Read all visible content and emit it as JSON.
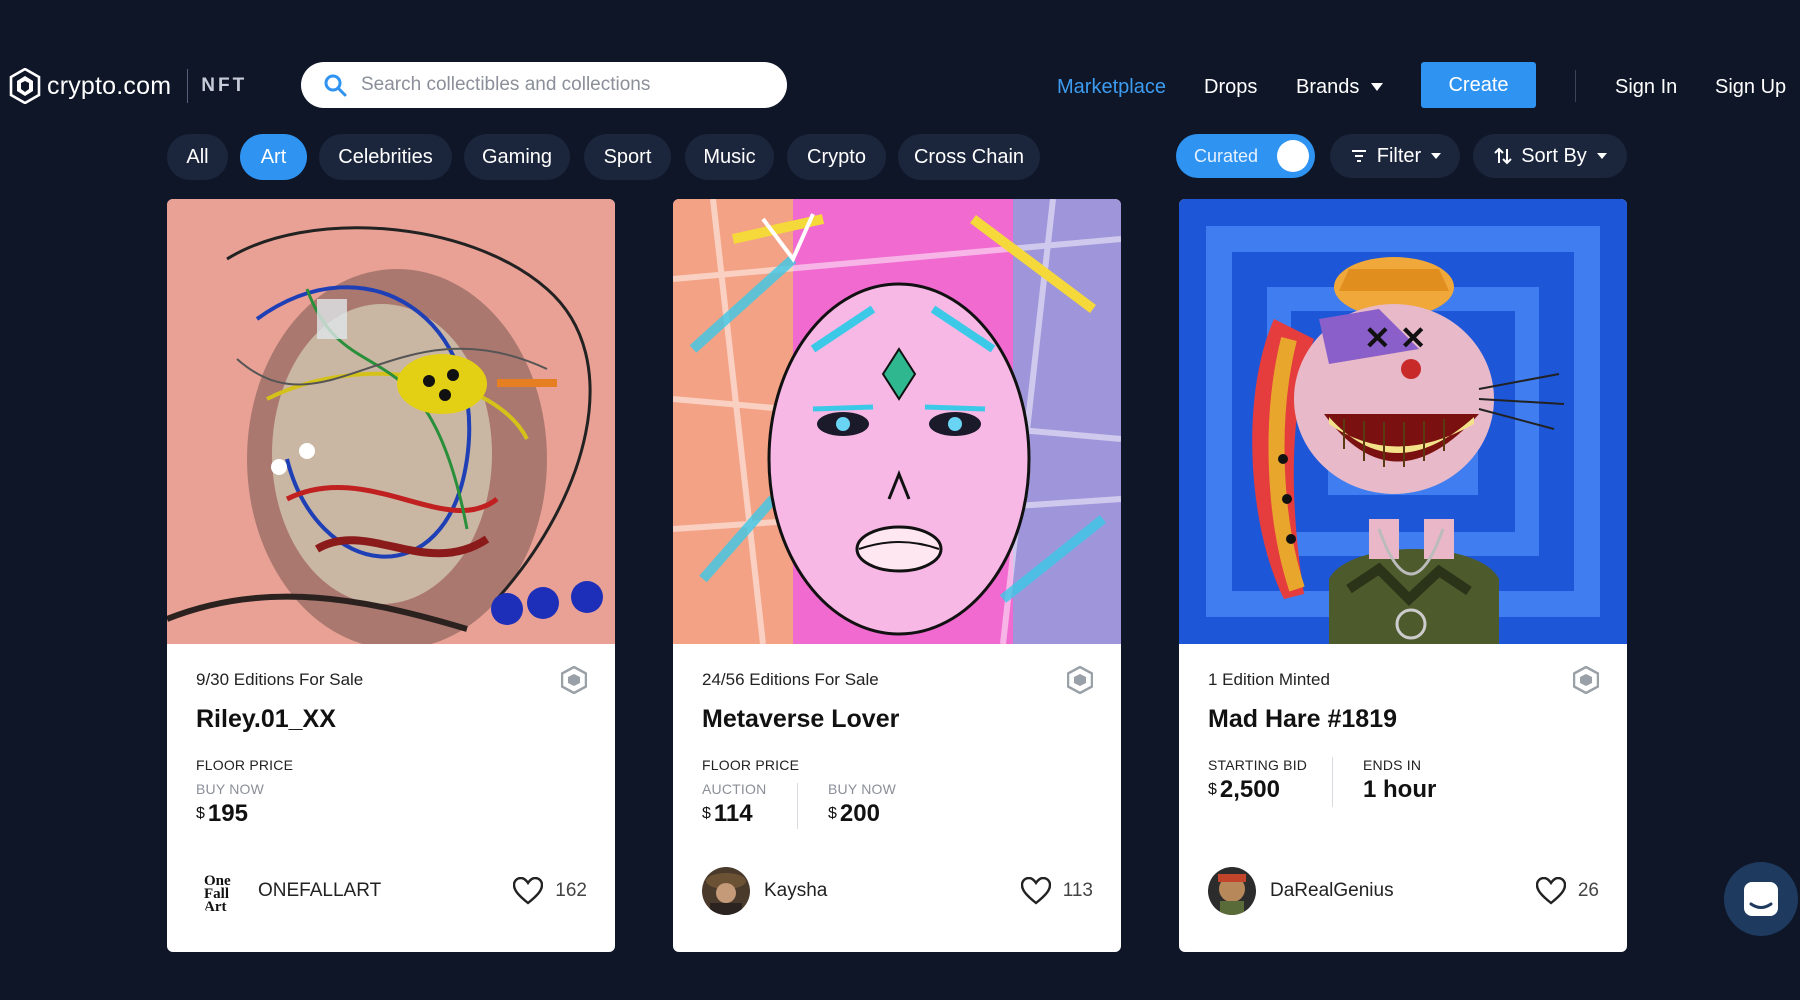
{
  "brand": {
    "name": "crypto.com",
    "section": "NFT"
  },
  "search": {
    "placeholder": "Search collectibles and collections"
  },
  "nav": {
    "marketplace": "Marketplace",
    "drops": "Drops",
    "brands": "Brands",
    "create": "Create",
    "sign_in": "Sign In",
    "sign_up": "Sign Up"
  },
  "categories": [
    "All",
    "Art",
    "Celebrities",
    "Gaming",
    "Sport",
    "Music",
    "Crypto",
    "Cross Chain"
  ],
  "active_category": "Art",
  "controls": {
    "curated": "Curated",
    "curated_on": true,
    "filter": "Filter",
    "sort": "Sort By"
  },
  "cards": [
    {
      "editions": "9/30 Editions For Sale",
      "title": "Riley.01_XX",
      "label1": "FLOOR PRICE",
      "sub1": "BUY NOW",
      "currency": "$",
      "price1": "195",
      "creator": "ONEFALLART",
      "likes": "162"
    },
    {
      "editions": "24/56 Editions For Sale",
      "title": "Metaverse Lover",
      "label1": "FLOOR PRICE",
      "sub1": "AUCTION",
      "sub2": "BUY NOW",
      "currency": "$",
      "price1": "114",
      "price2": "200",
      "creator": "Kaysha",
      "likes": "113"
    },
    {
      "editions": "1 Edition Minted",
      "title": "Mad Hare #1819",
      "label1": "STARTING BID",
      "label2": "ENDS IN",
      "currency": "$",
      "price1": "2,500",
      "ends": "1 hour",
      "creator": "DaRealGenius",
      "likes": "26"
    }
  ],
  "colors": {
    "background": "#0e1628",
    "accent": "#2e93f1",
    "pill": "#1b253b"
  }
}
